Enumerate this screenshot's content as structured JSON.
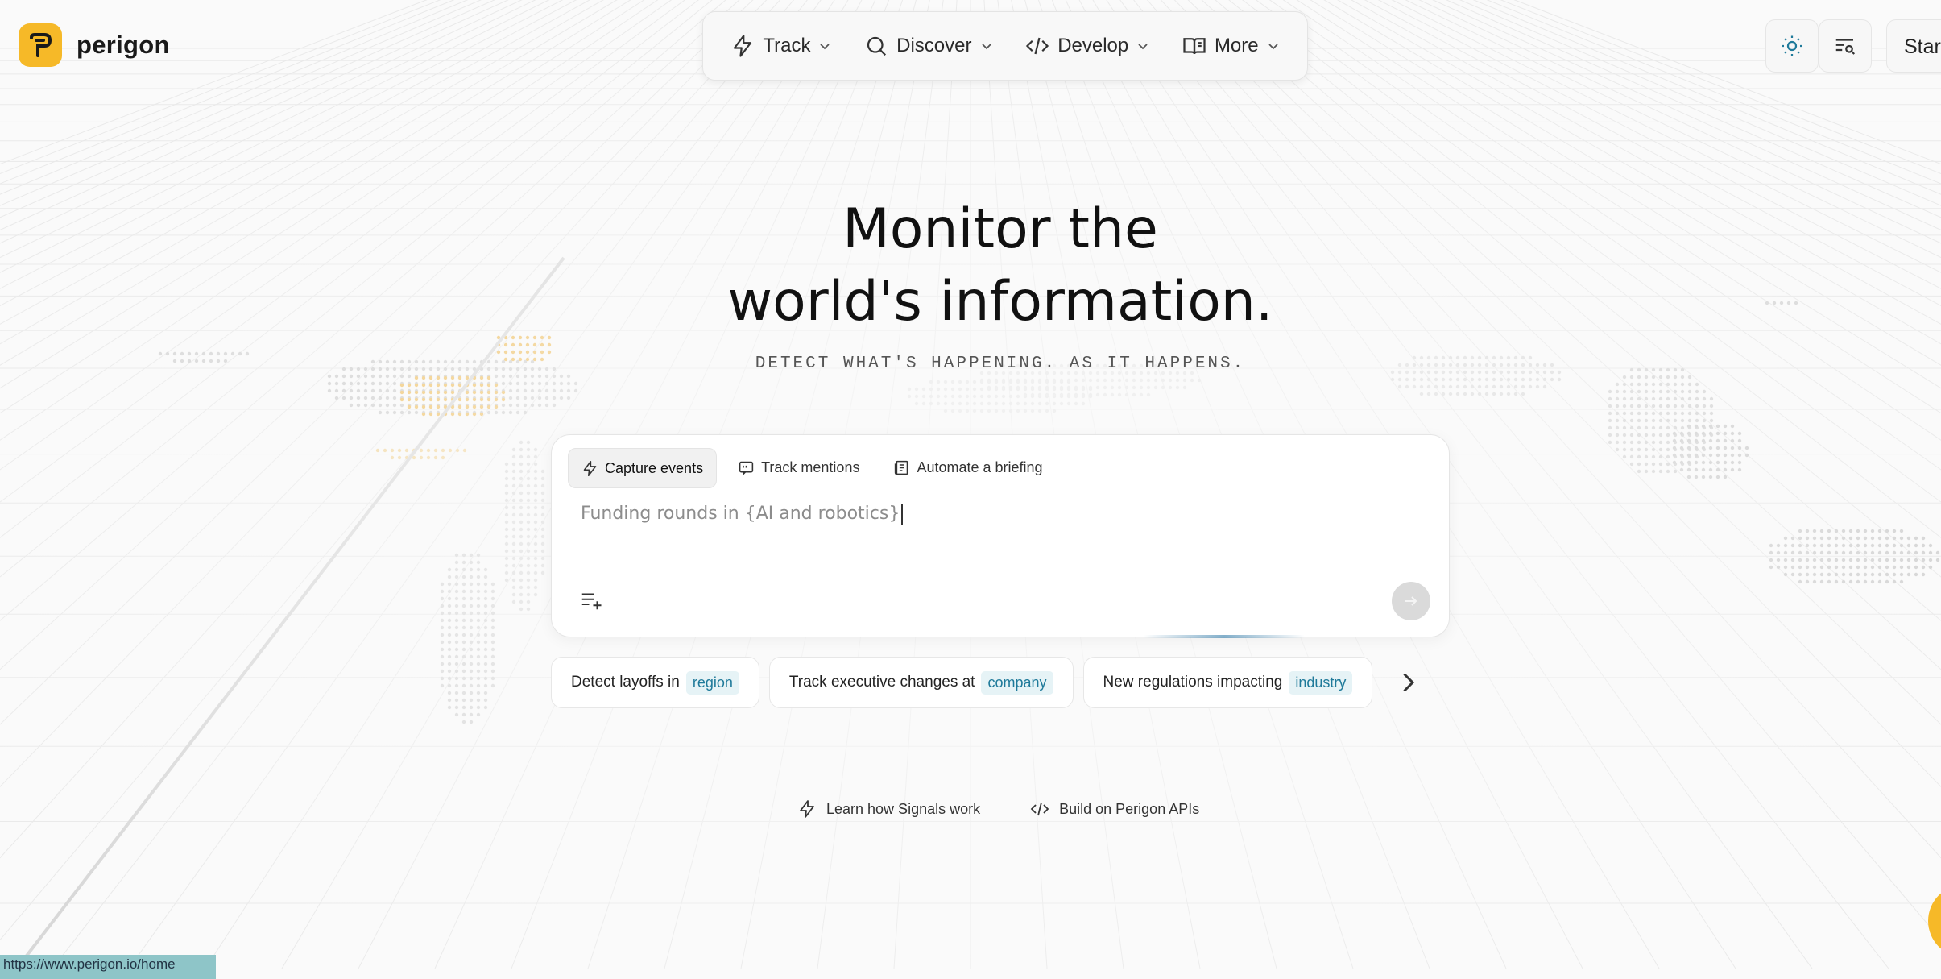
{
  "brand": {
    "name": "perigon",
    "logo_letter": "P",
    "accent": "#f6b928"
  },
  "nav": {
    "items": [
      {
        "label": "Track",
        "icon": "bolt-icon"
      },
      {
        "label": "Discover",
        "icon": "search-icon"
      },
      {
        "label": "Develop",
        "icon": "code-icon"
      },
      {
        "label": "More",
        "icon": "book-icon"
      }
    ]
  },
  "header_actions": {
    "theme_icon": "sun-icon",
    "search_icon": "search-list-icon",
    "start_label": "Start"
  },
  "hero": {
    "title_line1": "Monitor the",
    "title_line2": "world's information.",
    "subtitle": "DETECT WHAT'S HAPPENING. AS IT HAPPENS."
  },
  "composer": {
    "tabs": [
      {
        "label": "Capture events",
        "icon": "bolt-icon",
        "active": true
      },
      {
        "label": "Track mentions",
        "icon": "quote-icon",
        "active": false
      },
      {
        "label": "Automate a briefing",
        "icon": "newspaper-icon",
        "active": false
      }
    ],
    "prompt_text": "Funding rounds in {AI and robotics}",
    "add_list_icon": "list-add-icon",
    "send_icon": "arrow-right-icon"
  },
  "suggestions": [
    {
      "text": "Detect layoffs in",
      "tag": "region"
    },
    {
      "text": "Track executive changes at",
      "tag": "company"
    },
    {
      "text": "New regulations impacting",
      "tag": "industry"
    }
  ],
  "footer_links": [
    {
      "label": "Learn how Signals work",
      "icon": "bolt-icon"
    },
    {
      "label": "Build on Perigon APIs",
      "icon": "code-icon"
    }
  ],
  "status_url": "https://www.perigon.io/home",
  "colors": {
    "tag_bg": "#e6f3f6",
    "tag_text": "#1f7a9a",
    "background": "#fafafa"
  }
}
